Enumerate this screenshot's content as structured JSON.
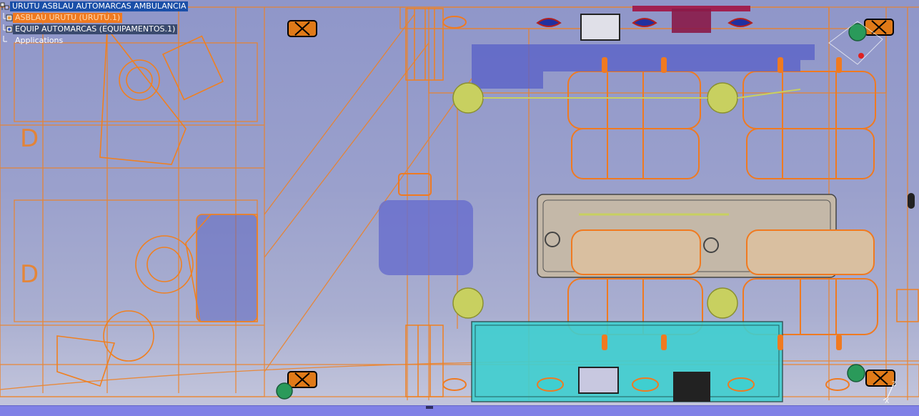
{
  "tree": {
    "root": {
      "label": "URUTU ASBLAU AUTOMARCAS AMBULANCIA",
      "icon": "assembly-icon"
    },
    "items": [
      {
        "label": "ASBLAU URUTU (URUTU.1)",
        "icon": "part-icon",
        "state": "selected"
      },
      {
        "label": "EQUIP AUTOMARCAS (EQUIPAMENTOS.1)",
        "icon": "product-icon",
        "state": "normal"
      },
      {
        "label": "Applications",
        "icon": "applications-icon",
        "state": "normal"
      }
    ]
  },
  "compass": {
    "axes": [
      "Z",
      "X"
    ]
  },
  "colors": {
    "wireframe": "#f08020",
    "background_top": "#8f96c9",
    "background_bottom": "#c6c8dd",
    "teal_panel": "#3fcfd0",
    "status_bar": "#8081e6",
    "lamp": "#c8d060"
  }
}
